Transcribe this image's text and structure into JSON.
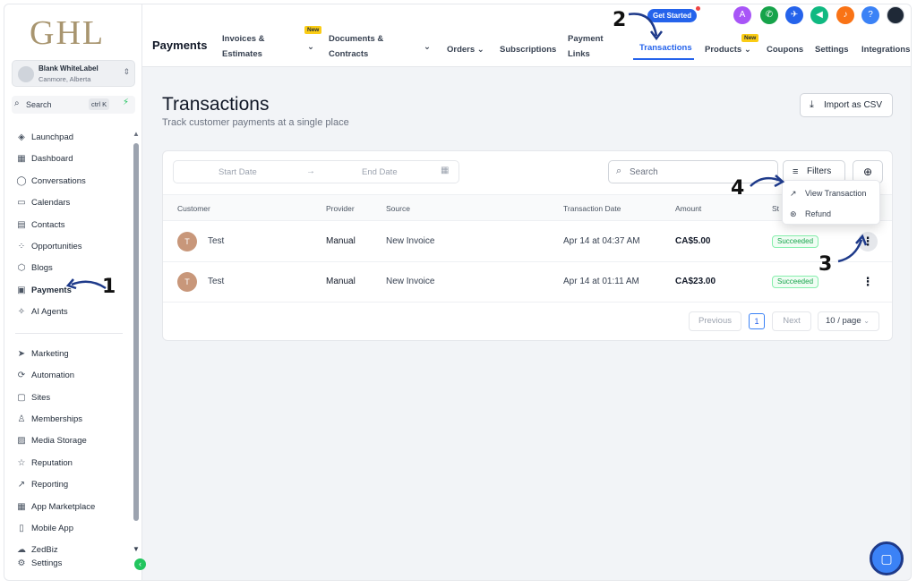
{
  "sidebar": {
    "logo": "GHL",
    "account": {
      "name": "Blank WhiteLabel",
      "location": "Canmore, Alberta"
    },
    "search": {
      "label": "Search",
      "shortcut": "ctrl K"
    },
    "items": [
      {
        "label": "Launchpad",
        "icon": "rocket-icon"
      },
      {
        "label": "Dashboard",
        "icon": "grid-icon"
      },
      {
        "label": "Conversations",
        "icon": "chat-icon"
      },
      {
        "label": "Calendars",
        "icon": "calendar-icon"
      },
      {
        "label": "Contacts",
        "icon": "contacts-icon"
      },
      {
        "label": "Opportunities",
        "icon": "opportunities-icon"
      },
      {
        "label": "Blogs",
        "icon": "blogs-icon"
      },
      {
        "label": "Payments",
        "icon": "payments-icon",
        "active": true
      },
      {
        "label": "AI Agents",
        "icon": "sparkle-icon"
      },
      {
        "label": "Marketing",
        "icon": "send-icon"
      },
      {
        "label": "Automation",
        "icon": "automation-icon"
      },
      {
        "label": "Sites",
        "icon": "sites-icon"
      },
      {
        "label": "Memberships",
        "icon": "memberships-icon"
      },
      {
        "label": "Media Storage",
        "icon": "image-icon"
      },
      {
        "label": "Reputation",
        "icon": "star-icon"
      },
      {
        "label": "Reporting",
        "icon": "chart-icon"
      },
      {
        "label": "App Marketplace",
        "icon": "apps-icon"
      },
      {
        "label": "Mobile App",
        "icon": "mobile-icon"
      },
      {
        "label": "ZedBiz",
        "icon": "brain-icon"
      },
      {
        "label": "Settings",
        "icon": "gear-icon"
      }
    ]
  },
  "topbar": {
    "title": "Payments",
    "tabs": {
      "invoices": "Invoices & Estimates",
      "documents": "Documents & Contracts",
      "orders": "Orders",
      "subscriptions": "Subscriptions",
      "payment_links": "Payment Links",
      "transactions": "Transactions",
      "products": "Products",
      "coupons": "Coupons",
      "settings": "Settings",
      "integrations": "Integrations"
    },
    "new_badge": "New",
    "get_started": "Get Started"
  },
  "main": {
    "title": "Transactions",
    "subtitle": "Track customer payments at a single place",
    "import_label": "Import as CSV",
    "start_date_placeholder": "Start Date",
    "end_date_placeholder": "End Date",
    "search_placeholder": "Search",
    "filters_label": "Filters",
    "columns": {
      "customer": "Customer",
      "provider": "Provider",
      "source": "Source",
      "date": "Transaction Date",
      "amount": "Amount",
      "status": "St"
    },
    "rows": [
      {
        "initial": "T",
        "customer": "Test",
        "provider": "Manual",
        "source": "New Invoice",
        "date": "Apr 14 at 04:37 AM",
        "amount": "CA$5.00",
        "status": "Succeeded"
      },
      {
        "initial": "T",
        "customer": "Test",
        "provider": "Manual",
        "source": "New Invoice",
        "date": "Apr 14 at 01:11 AM",
        "amount": "CA$23.00",
        "status": "Succeeded"
      }
    ],
    "pagination": {
      "previous": "Previous",
      "current": "1",
      "next": "Next",
      "per_page": "10 / page"
    },
    "menu": {
      "view": "View Transaction",
      "refund": "Refund"
    }
  },
  "annotations": {
    "step1": "1",
    "step2": "2",
    "step3": "3",
    "step4": "4"
  },
  "colors": {
    "accent": "#2563eb",
    "success": "#16a34a",
    "annotation": "#e11d1d",
    "logo": "#a8956f"
  }
}
